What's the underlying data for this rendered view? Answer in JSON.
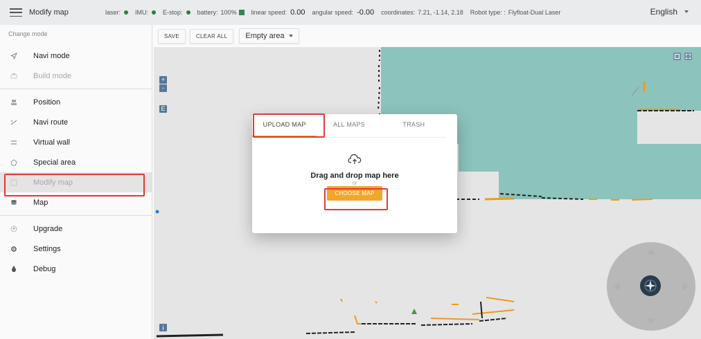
{
  "header": {
    "menu_icon": "hamburger-menu-icon",
    "title": "Modify map",
    "status": {
      "laser_label": "laser:",
      "imu_label": "IMU:",
      "estop_label": "E-stop:",
      "battery_label": "battery:",
      "battery_value": "100%",
      "linear_speed_label": "linear speed:",
      "linear_speed_value": "0.00",
      "angular_speed_label": "angular speed:",
      "angular_speed_value": "-0.00",
      "coordinates_label": "coordinates:",
      "coordinates_value": "7.21, -1.14, 2.18",
      "robot_type_label": "Robot type: :",
      "robot_type_value": "Flyfloat-Dual Laser",
      "ok_color": "#1e8a3e"
    },
    "language": "English"
  },
  "sidebar": {
    "change_mode_label": "Change mode",
    "modes": [
      {
        "label": "Navi mode",
        "icon": "navigation-arrow-icon"
      },
      {
        "label": "Build mode",
        "icon": "build-icon"
      }
    ],
    "tools": [
      {
        "label": "Position",
        "icon": "position-icon"
      },
      {
        "label": "Navi route",
        "icon": "route-icon"
      },
      {
        "label": "Virtual wall",
        "icon": "wall-icon"
      },
      {
        "label": "Special area",
        "icon": "area-icon"
      },
      {
        "label": "Modify map",
        "icon": "edit-map-icon"
      },
      {
        "label": "Map",
        "icon": "map-icon"
      }
    ],
    "system": [
      {
        "label": "Upgrade",
        "icon": "upgrade-icon"
      },
      {
        "label": "Settings",
        "icon": "settings-icon"
      },
      {
        "label": "Debug",
        "icon": "debug-icon"
      }
    ]
  },
  "toolbar": {
    "save_label": "SAVE",
    "clear_all_label": "CLEAR ALL",
    "area_select_value": "Empty area"
  },
  "dialog": {
    "tabs": [
      "UPLOAD MAP",
      "ALL MAPS",
      "TRASH"
    ],
    "active_tab": "UPLOAD MAP",
    "drop_title": "Drag and drop map here",
    "drop_or": "or",
    "choose_label": "CHOOSE MAP",
    "accent_color": "#f3a62b"
  },
  "map_controls": {
    "zoom_in": "+",
    "zoom_out": "-",
    "edit_label": "E"
  }
}
